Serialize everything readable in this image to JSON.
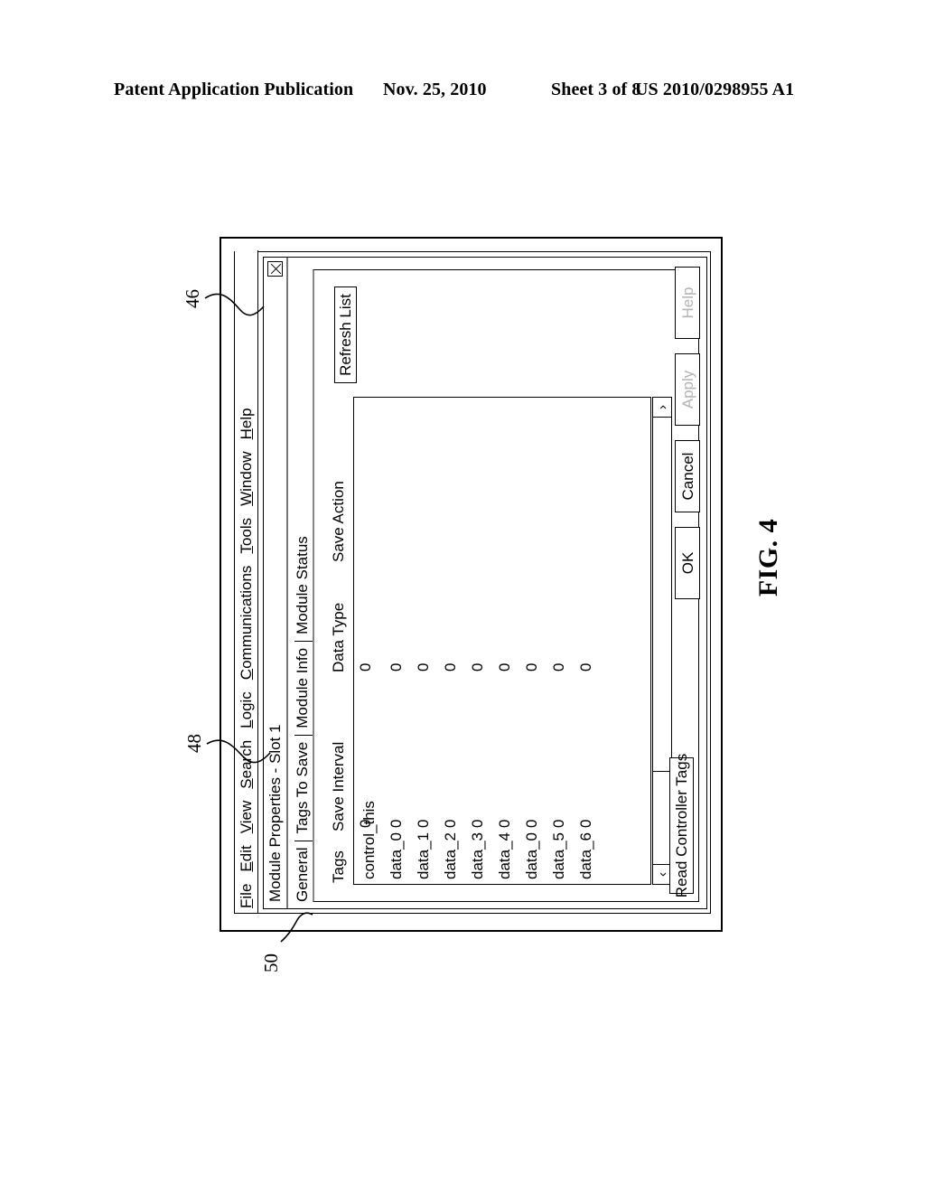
{
  "patent_header": {
    "publication": "Patent Application Publication",
    "date": "Nov. 25, 2010",
    "sheet": "Sheet 3 of 8",
    "number": "US 2010/0298955 A1"
  },
  "figure": {
    "label": "FIG. 4",
    "reference_numerals": {
      "menu_bar": "46",
      "dialog_title": "48",
      "outer_frame": "50"
    }
  },
  "menubar": {
    "items": [
      {
        "label": "File",
        "mnemonic": "F"
      },
      {
        "label": "Edit",
        "mnemonic": "E"
      },
      {
        "label": "View",
        "mnemonic": "V"
      },
      {
        "label": "Search",
        "mnemonic": "S"
      },
      {
        "label": "Logic",
        "mnemonic": "L"
      },
      {
        "label": "Communications",
        "mnemonic": "C"
      },
      {
        "label": "Tools",
        "mnemonic": "T"
      },
      {
        "label": "Window",
        "mnemonic": "W"
      },
      {
        "label": "Help",
        "mnemonic": "H"
      }
    ]
  },
  "dialog": {
    "title": "Module Properties - Slot 1",
    "close_glyph": "X",
    "tabs": [
      {
        "label": "General",
        "selected": false
      },
      {
        "label": "Tags To Save",
        "selected": true
      },
      {
        "label": "Module Info",
        "selected": false
      },
      {
        "label": "Module Status",
        "selected": false
      }
    ],
    "grid": {
      "columns": [
        "Tags",
        "Save Interval",
        "Data Type",
        "Save Action"
      ],
      "rows": [
        {
          "tag": "control_this",
          "save_interval": "0",
          "data_type": "0",
          "save_action": ""
        },
        {
          "tag": "data_0",
          "save_interval": "0",
          "data_type": "0",
          "save_action": ""
        },
        {
          "tag": "data_1",
          "save_interval": "0",
          "data_type": "0",
          "save_action": ""
        },
        {
          "tag": "data_2",
          "save_interval": "0",
          "data_type": "0",
          "save_action": ""
        },
        {
          "tag": "data_3",
          "save_interval": "0",
          "data_type": "0",
          "save_action": ""
        },
        {
          "tag": "data_4",
          "save_interval": "0",
          "data_type": "0",
          "save_action": ""
        },
        {
          "tag": "data_0",
          "save_interval": "0",
          "data_type": "0",
          "save_action": ""
        },
        {
          "tag": "data_5",
          "save_interval": "0",
          "data_type": "0",
          "save_action": ""
        },
        {
          "tag": "data_6",
          "save_interval": "0",
          "data_type": "0",
          "save_action": ""
        }
      ]
    },
    "scrollbar": {
      "left_arrow": "‹",
      "right_arrow": "›"
    },
    "buttons": {
      "refresh_list": "Refresh List",
      "read_controller_tags": "Read Controller Tags",
      "ok": "OK",
      "cancel": "Cancel",
      "apply": "Apply",
      "help": "Help"
    },
    "disabled_buttons": [
      "Apply",
      "Help"
    ]
  }
}
